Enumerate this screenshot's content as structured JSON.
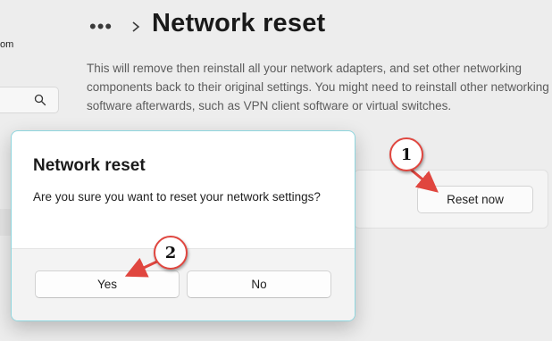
{
  "sidebar": {
    "account_text": "om",
    "search": {
      "icon": "search-icon",
      "value": ""
    }
  },
  "header": {
    "more_label": "•••",
    "chevron_icon": "chevron-right-icon",
    "title": "Network reset"
  },
  "main": {
    "description": "This will remove then reinstall all your network adapters, and set other networking components back to their original settings. You might need to reinstall other networking software afterwards, such as VPN client software or virtual switches.",
    "reset_button_label": "Reset now"
  },
  "dialog": {
    "title": "Network reset",
    "message": "Are you sure you want to reset your network settings?",
    "yes_label": "Yes",
    "no_label": "No",
    "border_color": "#8fd6de"
  },
  "annotations": [
    {
      "label": "1",
      "color": "#e0463f"
    },
    {
      "label": "2",
      "color": "#e0463f"
    }
  ]
}
